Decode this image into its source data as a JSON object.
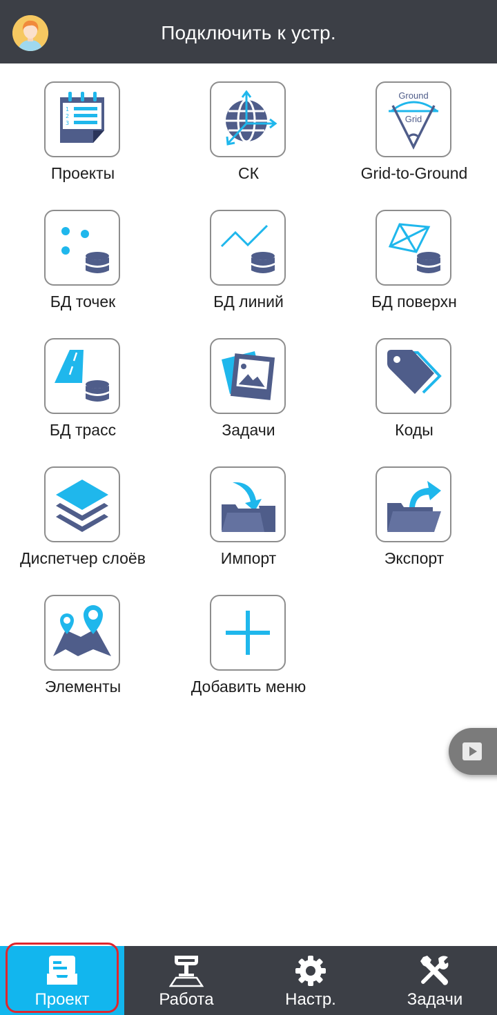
{
  "header": {
    "title": "Подключить к устр."
  },
  "tiles": [
    {
      "label": "Проекты",
      "icon": "projects-calendar-icon"
    },
    {
      "label": "СК",
      "icon": "coordinate-system-globe-icon"
    },
    {
      "label": "Grid-to-Ground",
      "icon": "grid-to-ground-icon",
      "icon_text_top": "Ground",
      "icon_text_bottom": "Grid"
    },
    {
      "label": "БД точек",
      "icon": "points-database-icon"
    },
    {
      "label": "БД линий",
      "icon": "lines-database-icon"
    },
    {
      "label": "БД поверхн",
      "icon": "surface-database-icon"
    },
    {
      "label": "БД трасс",
      "icon": "roads-database-icon"
    },
    {
      "label": "Задачи",
      "icon": "pictures-icon"
    },
    {
      "label": "Коды",
      "icon": "tag-icon"
    },
    {
      "label": "Диспетчер слоёв",
      "icon": "layers-icon"
    },
    {
      "label": "Импорт",
      "icon": "import-folder-icon"
    },
    {
      "label": "Экспорт",
      "icon": "export-folder-icon"
    },
    {
      "label": "Элементы",
      "icon": "map-pins-icon"
    },
    {
      "label": "Добавить меню",
      "icon": "plus-icon"
    }
  ],
  "bottom_nav": [
    {
      "label": "Проект",
      "icon": "project-tray-icon",
      "active": true
    },
    {
      "label": "Работа",
      "icon": "gnss-receiver-icon",
      "active": false
    },
    {
      "label": "Настр.",
      "icon": "gear-icon",
      "active": false
    },
    {
      "label": "Задачи",
      "icon": "tools-icon",
      "active": false
    }
  ],
  "colors": {
    "header_bg": "#3c3f46",
    "accent": "#12b6ee",
    "icon_dark": "#4f5d8a",
    "icon_light": "#1fb7ec",
    "highlight_outline": "#e0262d"
  }
}
